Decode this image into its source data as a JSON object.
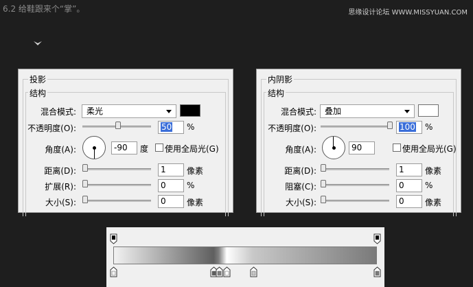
{
  "header": {
    "title": "6.2 给鞋跟来个“掌”。",
    "watermark": "思缘设计论坛 WWW.MISSYUAN.COM"
  },
  "drop_shadow": {
    "panel_title": "投影",
    "group_title": "结构",
    "blend_mode_label": "混合模式:",
    "blend_mode_value": "柔光",
    "swatch_color": "#000000",
    "opacity_label": "不透明度(O):",
    "opacity_value": "50",
    "opacity_percent": 50,
    "opacity_unit": "%",
    "angle_label": "角度(A):",
    "angle_value": "-90",
    "angle_degrees": -90,
    "angle_unit": "度",
    "global_light_label": "使用全局光(G)",
    "distance_label": "距离(D):",
    "distance_value": "1",
    "distance_unit": "像素",
    "spread_label": "扩展(R):",
    "spread_value": "0",
    "spread_unit": "%",
    "size_label": "大小(S):",
    "size_value": "0",
    "size_unit": "像素"
  },
  "inner_shadow": {
    "panel_title": "内阴影",
    "group_title": "结构",
    "blend_mode_label": "混合模式:",
    "blend_mode_value": "叠加",
    "swatch_color": "#ffffff",
    "opacity_label": "不透明度(O):",
    "opacity_value": "100",
    "opacity_percent": 100,
    "opacity_unit": "%",
    "angle_label": "角度(A):",
    "angle_value": "90",
    "angle_degrees": 90,
    "angle_unit": "度",
    "global_light_label": "使用全局光(G)",
    "distance_label": "距离(D):",
    "distance_value": "1",
    "distance_unit": "像素",
    "choke_label": "阻塞(C):",
    "choke_value": "0",
    "choke_unit": "%",
    "size_label": "大小(S):",
    "size_value": "0",
    "size_unit": "像素"
  },
  "gradient": {
    "opacity_stops": [
      {
        "location": 0,
        "color": "#000000"
      },
      {
        "location": 100,
        "color": "#000000"
      }
    ],
    "color_stops": [
      {
        "location": 0,
        "color": "#f2f2f2"
      },
      {
        "location": 38,
        "color": "#5f5f5f"
      },
      {
        "location": 40,
        "color": "#808080"
      },
      {
        "location": 43,
        "color": "#ffffff"
      },
      {
        "location": 53,
        "color": "#c8c8c8"
      },
      {
        "location": 100,
        "color": "#7a7a7a"
      }
    ]
  },
  "colors": {
    "background": "#1e1e1e",
    "panel": "#f0f0f0",
    "selection": "#3a6ed9"
  }
}
